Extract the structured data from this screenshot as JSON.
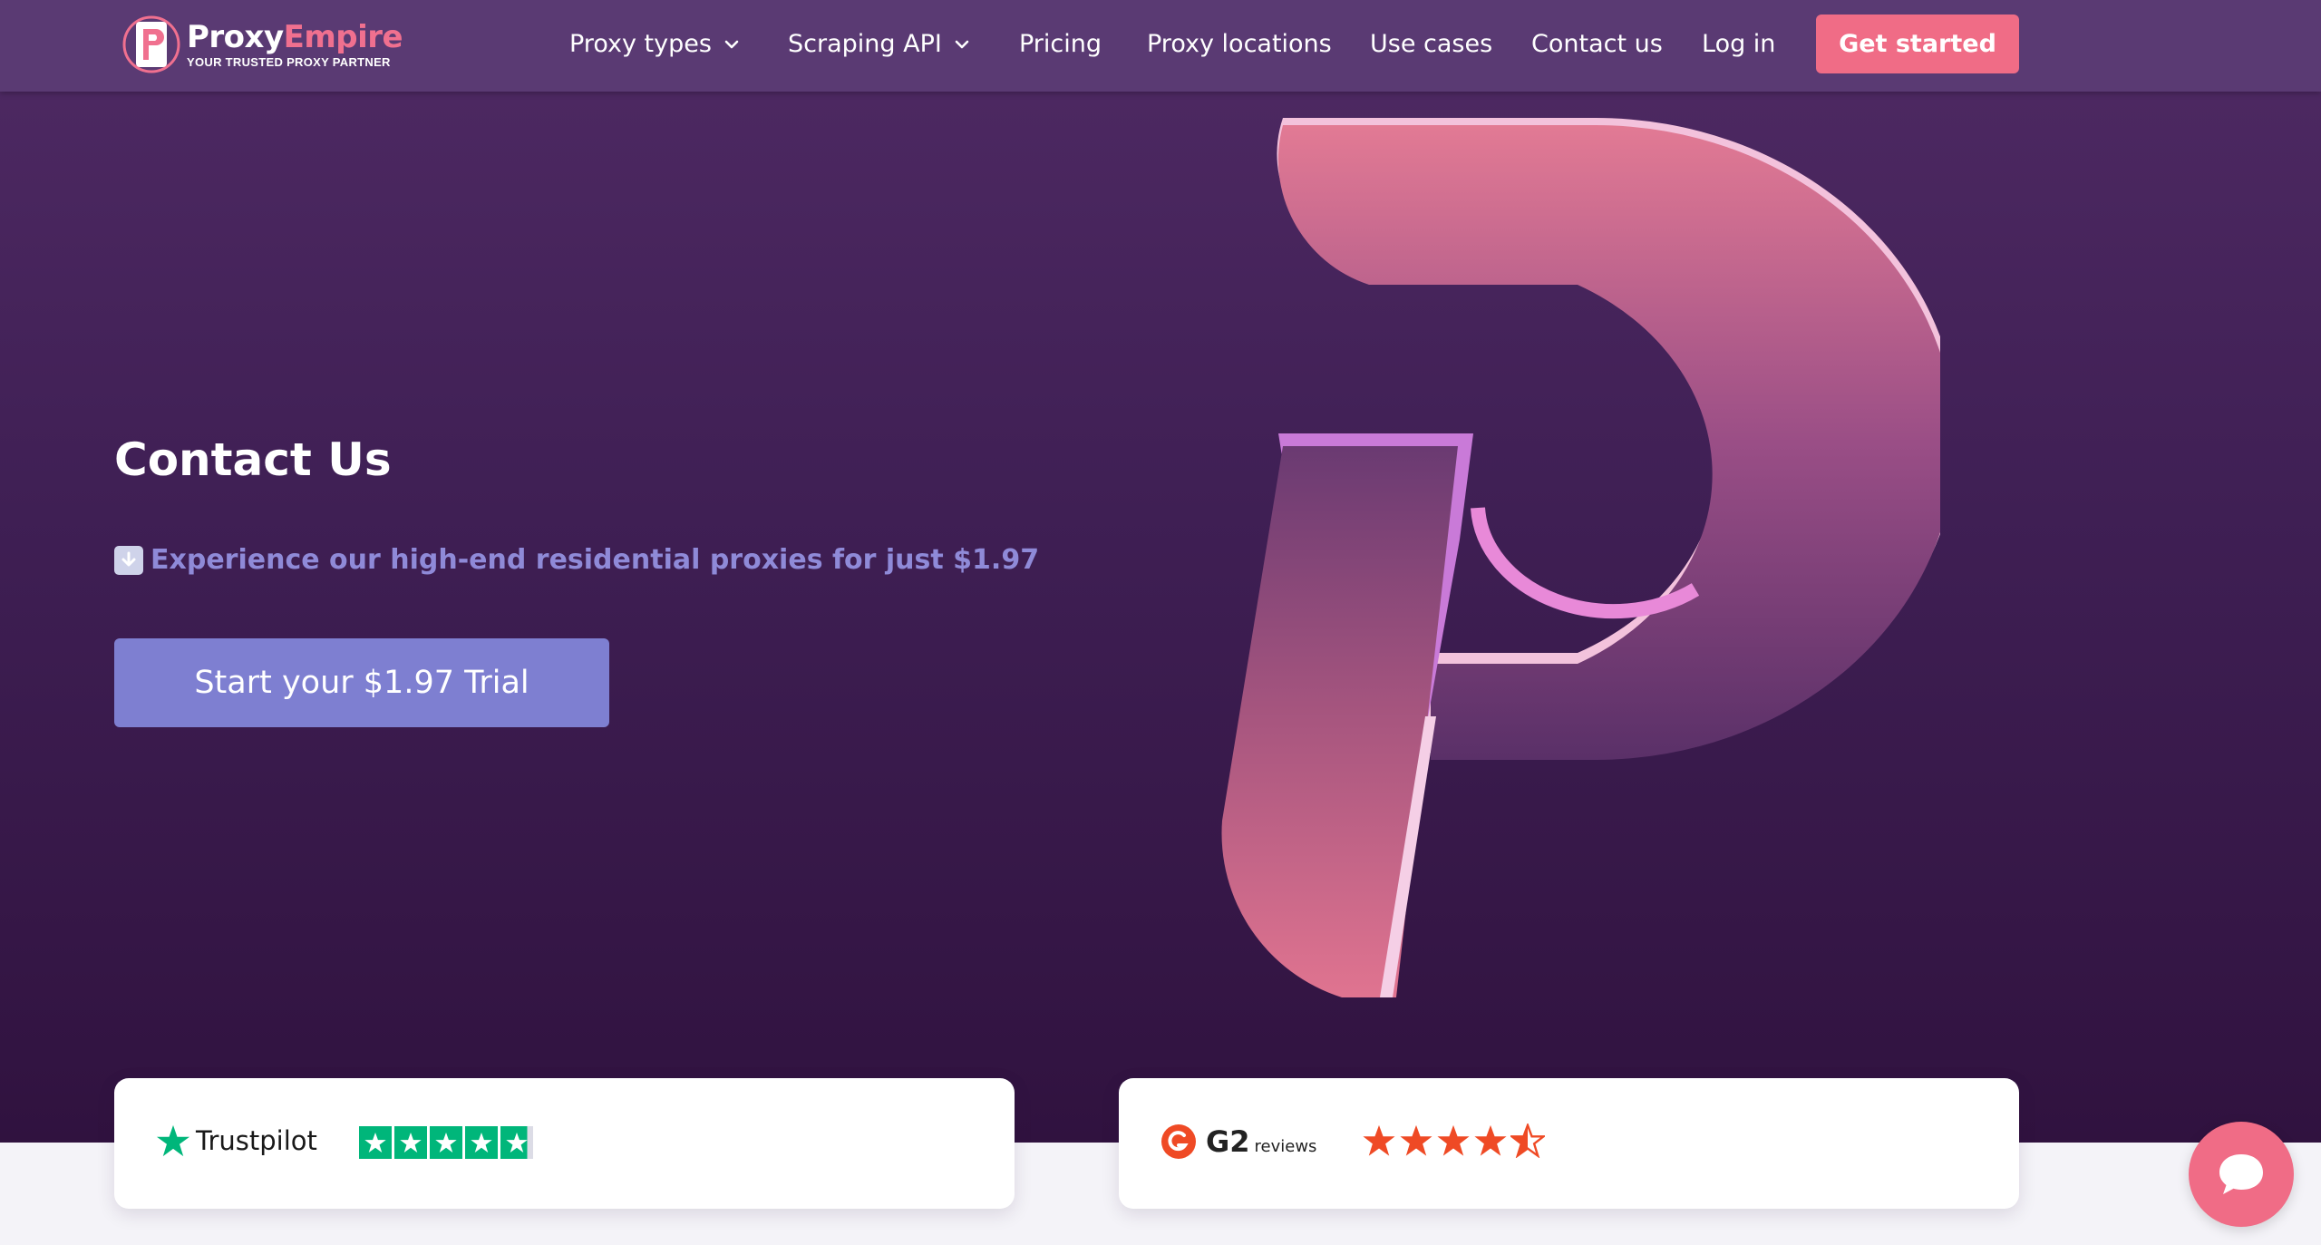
{
  "brand": {
    "name_part1": "Proxy",
    "name_part2": "Empire",
    "tagline": "YOUR TRUSTED PROXY PARTNER",
    "colors": {
      "primary": "#f06c86",
      "accent": "#7e7fd1",
      "hero_bg": "#4f2a64"
    }
  },
  "nav": {
    "items": [
      {
        "label": "Proxy types",
        "dropdown": true
      },
      {
        "label": "Scraping API",
        "dropdown": true
      },
      {
        "label": "Pricing",
        "dropdown": false
      },
      {
        "label": "Proxy locations",
        "dropdown": false
      },
      {
        "label": "Use cases",
        "dropdown": false
      },
      {
        "label": "Contact us",
        "dropdown": false
      },
      {
        "label": "Log in",
        "dropdown": false
      }
    ],
    "cta_label": "Get started"
  },
  "hero": {
    "title": "Contact Us",
    "offer_icon": "down-arrow-icon",
    "offer_text": "Experience our high-end residential proxies for just $1.97",
    "trial_button": "Start your $1.97 Trial"
  },
  "reviews": {
    "trustpilot": {
      "name": "Trustpilot",
      "rating": 4.8,
      "max": 5
    },
    "g2": {
      "name": "G2",
      "sublabel": "reviews",
      "rating": 4.5,
      "max": 5
    }
  },
  "chat": {
    "icon": "chat-bubble-icon"
  }
}
